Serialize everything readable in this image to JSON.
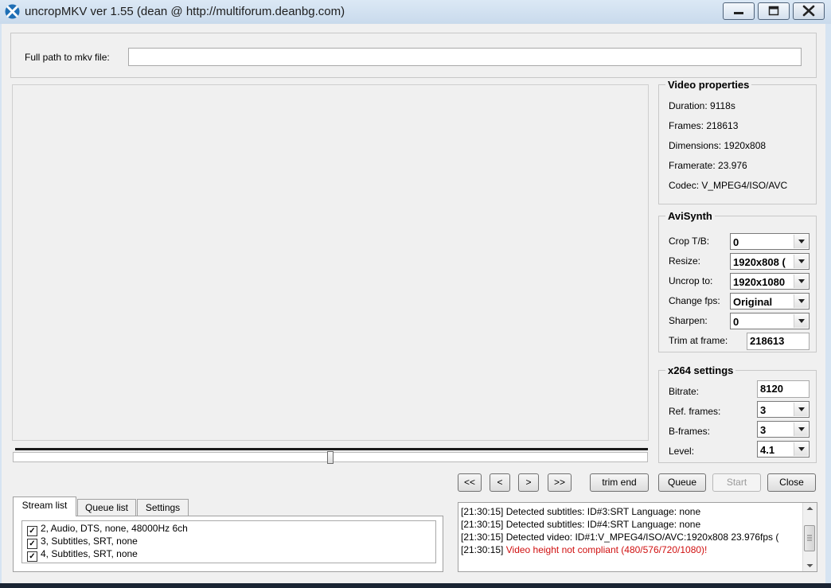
{
  "window": {
    "title": "uncropMKV ver 1.55 (dean @ http://multiforum.deanbg.com)",
    "icon": "x-logo-icon",
    "accent": "#1f6fb5"
  },
  "file": {
    "label": "Full path to mkv file:",
    "value": ""
  },
  "video_properties": {
    "title": "Video properties",
    "duration": "Duration: 9118s",
    "frames": "Frames: 218613",
    "dimensions": "Dimensions: 1920x808",
    "framerate": "Framerate: 23.976",
    "codec": "Codec: V_MPEG4/ISO/AVC"
  },
  "avisynth": {
    "title": "AviSynth",
    "crop_label": "Crop T/B:",
    "crop_value": "0",
    "resize_label": "Resize:",
    "resize_value": "1920x808 (",
    "uncrop_label": "Uncrop to:",
    "uncrop_value": "1920x1080",
    "fps_label": "Change fps:",
    "fps_value": "Original",
    "sharpen_label": "Sharpen:",
    "sharpen_value": "0",
    "trim_label": "Trim at frame:",
    "trim_value": "218613"
  },
  "x264": {
    "title": "x264 settings",
    "bitrate_label": "Bitrate:",
    "bitrate_value": "8120",
    "ref_label": "Ref. frames:",
    "ref_value": "3",
    "bframes_label": "B-frames:",
    "bframes_value": "3",
    "level_label": "Level:",
    "level_value": "4.1"
  },
  "slider": {
    "position_fraction": 0.5
  },
  "tabs": [
    {
      "label": "Stream list",
      "active": true
    },
    {
      "label": "Queue list",
      "active": false
    },
    {
      "label": "Settings",
      "active": false
    }
  ],
  "streams": [
    {
      "label": "2, Audio, DTS, none, 48000Hz 6ch",
      "checked": true
    },
    {
      "label": "3, Subtitles, SRT, none",
      "checked": true
    },
    {
      "label": "4, Subtitles, SRT, none",
      "checked": true
    }
  ],
  "buttons": {
    "first": "<<",
    "prev": "<",
    "next": ">",
    "last": ">>",
    "trim_end": "trim end",
    "queue": "Queue",
    "start": "Start",
    "close": "Close"
  },
  "log": [
    {
      "time": "[21:30:15]",
      "msg": "Detected subtitles: ID#3:SRT Language: none",
      "warn": false
    },
    {
      "time": "[21:30:15]",
      "msg": "Detected subtitles: ID#4:SRT Language: none",
      "warn": false
    },
    {
      "time": "[21:30:15]",
      "msg": "Detected video: ID#1:V_MPEG4/ISO/AVC:1920x808 23.976fps (",
      "warn": false
    },
    {
      "time": "[21:30:15]",
      "msg": "Video height not compliant (480/576/720/1080)!",
      "warn": true
    }
  ],
  "colors": {
    "warning": "#d01010",
    "panel": "#f0f0f0"
  }
}
